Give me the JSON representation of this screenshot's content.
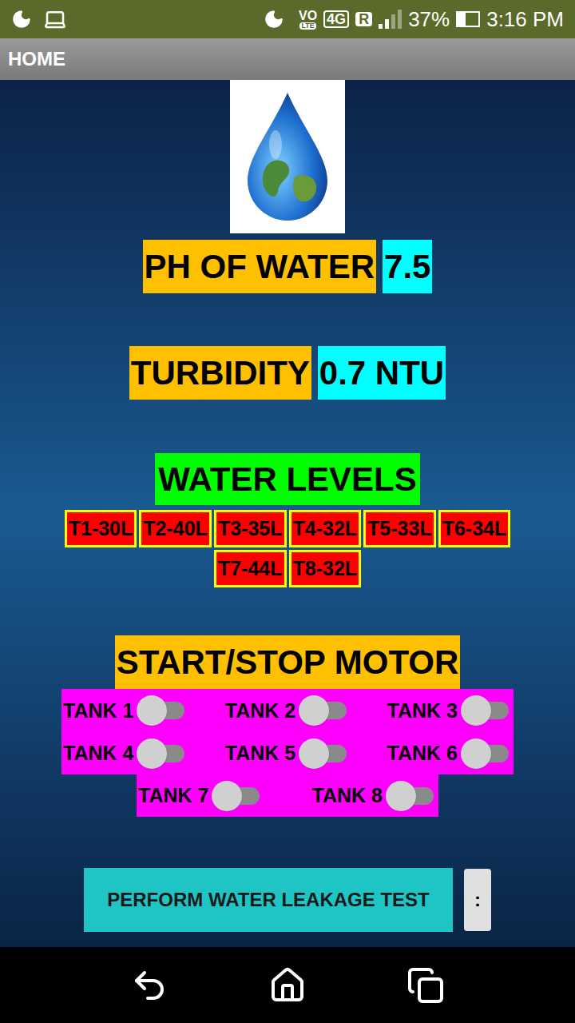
{
  "status_bar": {
    "volte_top": "VO",
    "volte_bottom": "LTE",
    "network": "4G",
    "roaming": "R",
    "signal": 0.5,
    "battery_text": "37%",
    "battery": 0.37,
    "time": "3:16 PM"
  },
  "app_bar": {
    "title": "HOME"
  },
  "ph": {
    "label": "PH OF WATER",
    "value": "7.5"
  },
  "turbidity": {
    "label": "TURBIDITY",
    "value": "0.7 NTU"
  },
  "water_levels": {
    "title": "WATER LEVELS",
    "tanks": [
      {
        "label": "T1-30L"
      },
      {
        "label": "T2-40L"
      },
      {
        "label": "T3-35L"
      },
      {
        "label": "T4-32L"
      },
      {
        "label": "T5-33L"
      },
      {
        "label": "T6-34L"
      },
      {
        "label": "T7-44L"
      },
      {
        "label": "T8-32L"
      }
    ]
  },
  "motor": {
    "title": "START/STOP MOTOR",
    "tanks": [
      {
        "label": "TANK 1",
        "on": false
      },
      {
        "label": "TANK 2",
        "on": false
      },
      {
        "label": "TANK 3",
        "on": false
      },
      {
        "label": "TANK 4",
        "on": false
      },
      {
        "label": "TANK 5",
        "on": false
      },
      {
        "label": "TANK 6",
        "on": false
      },
      {
        "label": "TANK 7",
        "on": false
      },
      {
        "label": "TANK 8",
        "on": false
      }
    ]
  },
  "leak_button": {
    "label": "PERFORM WATER LEAKAGE TEST"
  },
  "menu_button": {
    "label": ":"
  }
}
